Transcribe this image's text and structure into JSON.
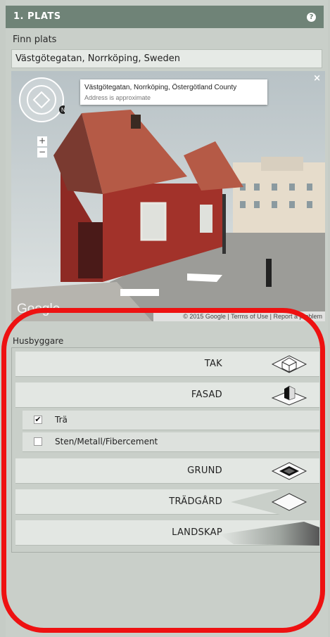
{
  "section": {
    "title": "1. PLATS",
    "help_icon": "?"
  },
  "location": {
    "label": "Finn plats",
    "value": "Västgötegatan, Norrköping, Sweden"
  },
  "streetview": {
    "address": "Västgötegatan, Norrköping, Östergötland County",
    "approx": "Address is approximate",
    "close": "×",
    "zoom_in": "+",
    "zoom_out": "−",
    "brand": "Google",
    "footer": "© 2015 Google | Terms of Use | Report a problem"
  },
  "builder": {
    "label": "Husbyggare",
    "rows": [
      {
        "label": "TAK",
        "icon": "roof-icon"
      },
      {
        "label": "FASAD",
        "icon": "facade-icon"
      },
      {
        "label": "GRUND",
        "icon": "foundation-icon"
      },
      {
        "label": "TRÄDGÅRD",
        "icon": "garden-icon"
      },
      {
        "label": "LANDSKAP",
        "icon": "landscape-icon"
      }
    ],
    "facade_options": [
      {
        "label": "Trä",
        "checked": true
      },
      {
        "label": "Sten/Metall/Fibercement",
        "checked": false
      }
    ]
  },
  "colors": {
    "header": "#6f8377",
    "panel": "#c9cfc9",
    "highlight": "#ee1111"
  }
}
